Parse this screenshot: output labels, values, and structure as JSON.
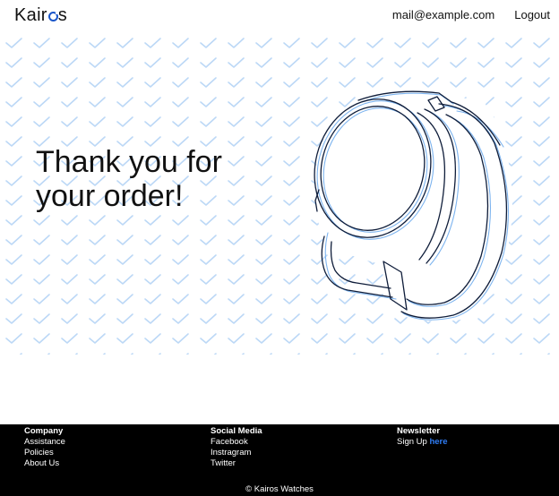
{
  "header": {
    "logo_prefix": "Kair",
    "logo_suffix": "s",
    "email": "mail@example.com",
    "logout_label": "Logout"
  },
  "hero": {
    "title_line1": "Thank you for",
    "title_line2": "your order!"
  },
  "footer": {
    "company": {
      "heading": "Company",
      "links": [
        "Assistance",
        "Policies",
        "About Us"
      ]
    },
    "social": {
      "heading": "Social Media",
      "links": [
        "Facebook",
        "Instragram",
        "Twitter"
      ]
    },
    "newsletter": {
      "heading": "Newsletter",
      "text": "Sign Up",
      "link": "here"
    },
    "copyright": "© Kairos Watches"
  },
  "colors": {
    "accent": "#1a56c9",
    "link_blue": "#2f7df6",
    "check_pattern": "#bcd8f6",
    "footer_bg": "#000000"
  },
  "icons": {
    "background": "checkmark-pattern",
    "illustration": "smartwatch-line-drawing"
  }
}
